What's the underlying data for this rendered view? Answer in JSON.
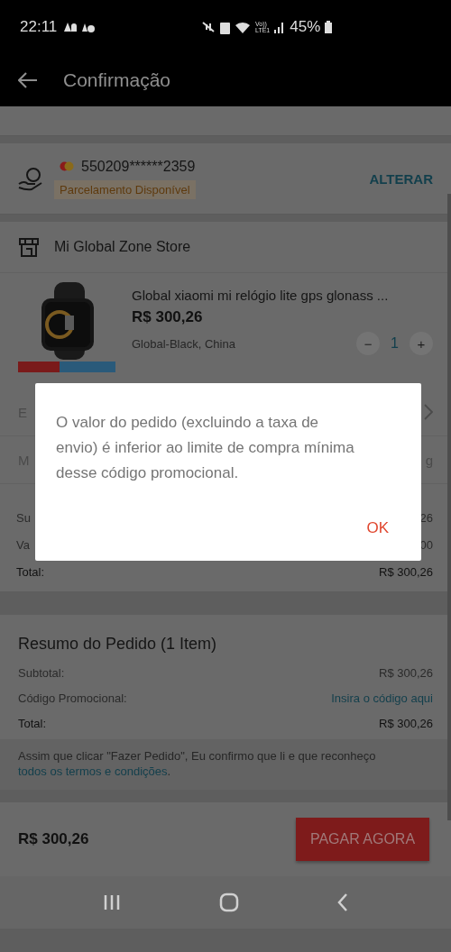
{
  "status_bar": {
    "time": "22:11",
    "volte": "Vo))",
    "lte": "LTE1",
    "battery": "45%"
  },
  "header": {
    "title": "Confirmação"
  },
  "payment": {
    "card_number": "550209******2359",
    "badge": "Parcelamento Disponível",
    "action": "ALTERAR"
  },
  "store": {
    "name": "Mi Global Zone Store"
  },
  "product": {
    "title": "Global xiaomi mi relógio lite gps glonass ...",
    "price": "R$ 300,26",
    "variant": "Global-Black, China",
    "decrease": "−",
    "quantity": "1",
    "increase": "+"
  },
  "store_rows": [
    {
      "kind": "link",
      "label": "E"
    },
    {
      "kind": "value",
      "label": "M",
      "value": "g"
    }
  ],
  "store_totals": [
    {
      "kind": "line",
      "label": "Su",
      "value": "26"
    },
    {
      "kind": "line",
      "label": "Va",
      "value": "00"
    },
    {
      "kind": "total",
      "label": "Total:",
      "value": "R$ 300,26"
    }
  ],
  "dialog": {
    "message": "O valor do pedido (excluindo a taxa de envio) é inferior ao limite de compra mínima desse código promocional.",
    "button": "OK"
  },
  "summary": {
    "title": "Resumo do Pedido (1 Item)",
    "rows": [
      {
        "kind": "line",
        "label": "Subtotal:",
        "value": "R$ 300,26"
      },
      {
        "kind": "link",
        "label": "Código Promocional:",
        "value": "Insira o código aqui"
      },
      {
        "kind": "total",
        "label": "Total:",
        "value": "R$ 300,26"
      }
    ],
    "notice": "Assim que clicar \"Fazer Pedido\", Eu confirmo que li e que reconheço",
    "notice_link": "todos os termos e condições",
    "notice_end": "."
  },
  "checkout": {
    "total": "R$ 300,26",
    "button": "PAGAR AGORA"
  }
}
